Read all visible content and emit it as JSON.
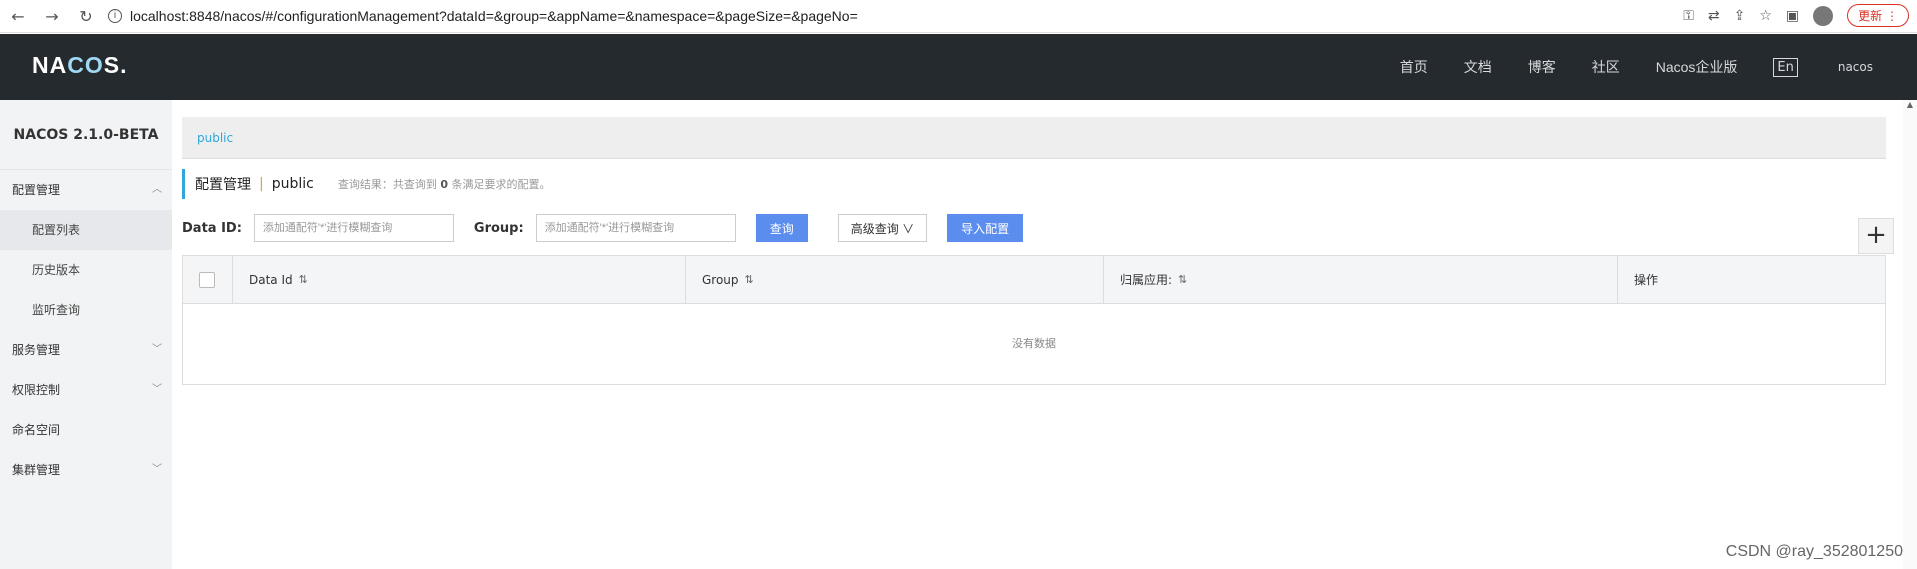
{
  "browser": {
    "url": "localhost:8848/nacos/#/configurationManagement?dataId=&group=&appName=&namespace=&pageSize=&pageNo=",
    "update_label": "更新"
  },
  "header": {
    "logo": "NACOS.",
    "nav": [
      "首页",
      "文档",
      "博客",
      "社区",
      "Nacos企业版"
    ],
    "lang": "En",
    "user": "nacos"
  },
  "sidebar": {
    "version": "NACOS 2.1.0-BETA",
    "menu": [
      {
        "label": "配置管理",
        "expanded": true,
        "children": [
          "配置列表",
          "历史版本",
          "监听查询"
        ]
      },
      {
        "label": "服务管理"
      },
      {
        "label": "权限控制"
      },
      {
        "label": "命名空间"
      },
      {
        "label": "集群管理"
      }
    ]
  },
  "main": {
    "namespace_tab": "public",
    "title": "配置管理",
    "title_sep": "|",
    "namespace": "public",
    "result_prefix": "查询结果：共查询到",
    "result_count": "0",
    "result_suffix": "条满足要求的配置。",
    "dataid_label": "Data ID:",
    "dataid_placeholder": "添加通配符'*'进行模糊查询",
    "group_label": "Group:",
    "group_placeholder": "添加通配符'*'进行模糊查询",
    "query_button": "查询",
    "advanced_query": "高级查询",
    "import_button": "导入配置",
    "plus": "+",
    "columns": [
      "Data Id",
      "Group",
      "归属应用:",
      "操作"
    ],
    "empty_text": "没有数据"
  },
  "watermark": "CSDN @ray_352801250"
}
